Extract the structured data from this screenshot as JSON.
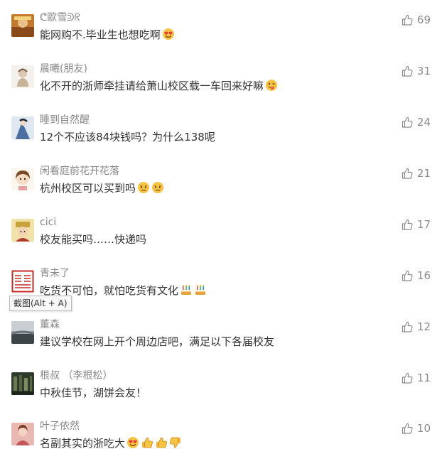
{
  "comments": [
    {
      "name": "ᕦ歐雪ᕲᖇ",
      "text": "能网购不.毕业生也想吃啊",
      "likes": "69",
      "emojis": [
        "heart-eyes"
      ]
    },
    {
      "name": "晨曦(朋友)",
      "text": "化不开的浙师牵挂请给萧山校区载一车回来好嘛",
      "likes": "31",
      "emojis": [
        "wink-tongue"
      ]
    },
    {
      "name": "睡到自然醒",
      "text": "12个不应该84块钱吗？为什么138呢",
      "likes": "24",
      "emojis": []
    },
    {
      "name": "闲看庭前花开花落",
      "text": "杭州校区可以买到吗",
      "likes": "21",
      "emojis": [
        "sad",
        "sad"
      ]
    },
    {
      "name": "cici",
      "text": "校友能买吗……快递吗",
      "likes": "17",
      "emojis": []
    },
    {
      "name": "青未了",
      "text": "吃货不可怕，就怕吃货有文化",
      "likes": "16",
      "emojis": [
        "cake",
        "cake"
      ]
    },
    {
      "name": "董森",
      "text": "建议学校在网上开个周边店吧，满足以下各届校友",
      "likes": "12",
      "emojis": []
    },
    {
      "name": "根叔 （李根松）",
      "text": "中秋佳节，湖饼会友！",
      "likes": "11",
      "emojis": []
    },
    {
      "name": "叶子依然",
      "text": "名副其实的浙吃大",
      "likes": "10",
      "emojis": [
        "heart-eyes",
        "thumbs-up",
        "thumbs-up",
        "thumbs-down"
      ]
    }
  ],
  "tooltip": {
    "text": "截图(Alt + A)"
  },
  "colors": {
    "name": "#888888",
    "text": "#333333",
    "like": "#8b8b8b"
  }
}
